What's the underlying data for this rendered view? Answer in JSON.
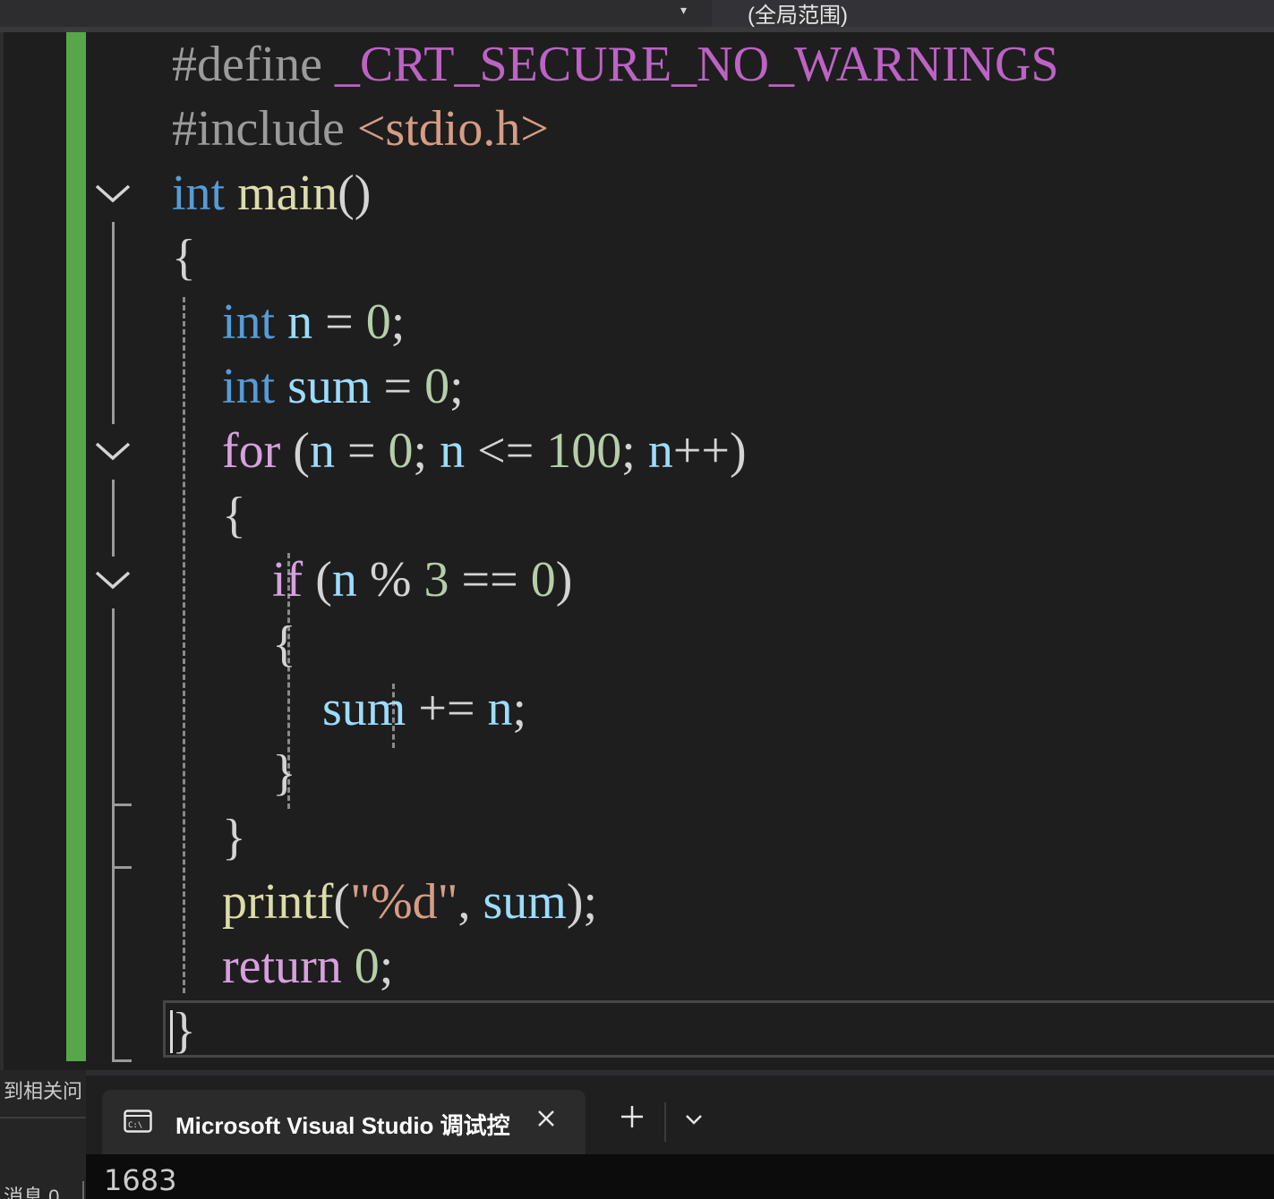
{
  "nav": {
    "dropdown_arrow": "▾",
    "scope_label": "(全局范围)"
  },
  "code": {
    "lines": [
      {
        "tokens": [
          {
            "t": "#define",
            "c": "pp"
          },
          {
            "t": " ",
            "c": "pun"
          },
          {
            "t": "_CRT_SECURE_NO_WARNINGS",
            "c": "mac"
          }
        ]
      },
      {
        "tokens": [
          {
            "t": "#include",
            "c": "pp"
          },
          {
            "t": " ",
            "c": "pun"
          },
          {
            "t": "<stdio.h>",
            "c": "inc"
          }
        ]
      },
      {
        "tokens": [
          {
            "t": "int",
            "c": "kw"
          },
          {
            "t": " ",
            "c": "pun"
          },
          {
            "t": "main",
            "c": "fn"
          },
          {
            "t": "()",
            "c": "pun"
          }
        ]
      },
      {
        "tokens": [
          {
            "t": "{",
            "c": "pun"
          }
        ]
      },
      {
        "tokens": [
          {
            "t": "    ",
            "c": "pun"
          },
          {
            "t": "int",
            "c": "kw"
          },
          {
            "t": " ",
            "c": "pun"
          },
          {
            "t": "n",
            "c": "var"
          },
          {
            "t": " = ",
            "c": "pun"
          },
          {
            "t": "0",
            "c": "num"
          },
          {
            "t": ";",
            "c": "pun"
          }
        ]
      },
      {
        "tokens": [
          {
            "t": "    ",
            "c": "pun"
          },
          {
            "t": "int",
            "c": "kw"
          },
          {
            "t": " ",
            "c": "pun"
          },
          {
            "t": "sum",
            "c": "var"
          },
          {
            "t": " = ",
            "c": "pun"
          },
          {
            "t": "0",
            "c": "num"
          },
          {
            "t": ";",
            "c": "pun"
          }
        ]
      },
      {
        "tokens": [
          {
            "t": "    ",
            "c": "pun"
          },
          {
            "t": "for",
            "c": "ctl"
          },
          {
            "t": " (",
            "c": "pun"
          },
          {
            "t": "n",
            "c": "var"
          },
          {
            "t": " = ",
            "c": "pun"
          },
          {
            "t": "0",
            "c": "num"
          },
          {
            "t": "; ",
            "c": "pun"
          },
          {
            "t": "n",
            "c": "var"
          },
          {
            "t": " <= ",
            "c": "pun"
          },
          {
            "t": "100",
            "c": "num"
          },
          {
            "t": "; ",
            "c": "pun"
          },
          {
            "t": "n",
            "c": "var"
          },
          {
            "t": "++)",
            "c": "pun"
          }
        ]
      },
      {
        "tokens": [
          {
            "t": "    {",
            "c": "pun"
          }
        ]
      },
      {
        "tokens": [
          {
            "t": "        ",
            "c": "pun"
          },
          {
            "t": "if",
            "c": "ctl"
          },
          {
            "t": " (",
            "c": "pun"
          },
          {
            "t": "n",
            "c": "var"
          },
          {
            "t": " % ",
            "c": "pun"
          },
          {
            "t": "3",
            "c": "num"
          },
          {
            "t": " == ",
            "c": "pun"
          },
          {
            "t": "0",
            "c": "num"
          },
          {
            "t": ")",
            "c": "pun"
          }
        ]
      },
      {
        "tokens": [
          {
            "t": "        {",
            "c": "pun"
          }
        ]
      },
      {
        "tokens": [
          {
            "t": "            ",
            "c": "pun"
          },
          {
            "t": "sum",
            "c": "var"
          },
          {
            "t": " += ",
            "c": "pun"
          },
          {
            "t": "n",
            "c": "var"
          },
          {
            "t": ";",
            "c": "pun"
          }
        ]
      },
      {
        "tokens": [
          {
            "t": "        }",
            "c": "pun"
          }
        ]
      },
      {
        "tokens": [
          {
            "t": "    }",
            "c": "pun"
          }
        ]
      },
      {
        "tokens": [
          {
            "t": "    ",
            "c": "pun"
          },
          {
            "t": "printf",
            "c": "fn"
          },
          {
            "t": "(",
            "c": "pun"
          },
          {
            "t": "\"%d\"",
            "c": "str"
          },
          {
            "t": ", ",
            "c": "pun"
          },
          {
            "t": "sum",
            "c": "var"
          },
          {
            "t": ");",
            "c": "pun"
          }
        ]
      },
      {
        "tokens": [
          {
            "t": "    ",
            "c": "pun"
          },
          {
            "t": "return",
            "c": "ctl"
          },
          {
            "t": " ",
            "c": "pun"
          },
          {
            "t": "0",
            "c": "num"
          },
          {
            "t": ";",
            "c": "pun"
          }
        ]
      },
      {
        "tokens": [
          {
            "t": "}",
            "c": "pun"
          }
        ]
      }
    ]
  },
  "error_list": {
    "title": "到相关问",
    "messages": "消息 0"
  },
  "console": {
    "tab_title": "Microsoft Visual Studio 调试控",
    "output": "1683"
  }
}
